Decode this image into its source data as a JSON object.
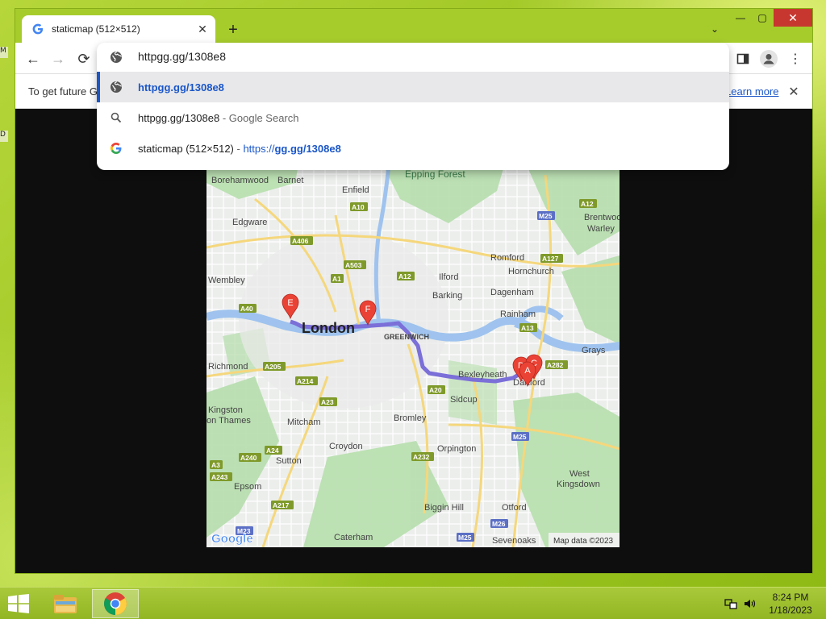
{
  "desktop": {
    "left_edge_items": [
      "M",
      "D"
    ]
  },
  "browser": {
    "tab_title": "staticmap (512×512)",
    "tab_close": "✕",
    "new_tab": "+",
    "tab_search": "⌄",
    "window_controls": {
      "minimize": "—",
      "maximize": "▢",
      "close": "✕"
    },
    "nav": {
      "back": "←",
      "forward": "→",
      "reload": "⟳"
    },
    "menu": "⋮",
    "infobar": {
      "text": "To get future G",
      "link": "Learn more",
      "close": "✕"
    }
  },
  "omnibox": {
    "input_value": "httpgg.gg/1308e8",
    "suggestions": [
      {
        "icon": "globe-icon",
        "parts": [
          {
            "text": "httpgg.gg/1308e8",
            "style": "bold-blue"
          }
        ],
        "selected": true
      },
      {
        "icon": "search-icon",
        "parts": [
          {
            "text": "httpgg.gg/1308e8",
            "style": ""
          },
          {
            "text": " - Google Search",
            "style": "muted"
          }
        ],
        "selected": false
      },
      {
        "icon": "google-icon",
        "parts": [
          {
            "text": "staticmap (512×512)",
            "style": ""
          },
          {
            "text": " - ",
            "style": "muted"
          },
          {
            "text": "https://",
            "style": "link-blue"
          },
          {
            "text": "gg.gg/1308e8",
            "style": "bold-blue"
          }
        ],
        "selected": false
      }
    ]
  },
  "map": {
    "city_label": "London",
    "attribution": "Map data ©2023",
    "logo": "Google",
    "places": [
      {
        "name": "Epping Forest"
      },
      {
        "name": "Borehamwood"
      },
      {
        "name": "Barnet"
      },
      {
        "name": "Enfield"
      },
      {
        "name": "Edgware"
      },
      {
        "name": "Brentwood"
      },
      {
        "name": "Warley"
      },
      {
        "name": "Romford"
      },
      {
        "name": "Hornchurch"
      },
      {
        "name": "Wembley"
      },
      {
        "name": "Ilford"
      },
      {
        "name": "Dagenham"
      },
      {
        "name": "Barking"
      },
      {
        "name": "Rainham"
      },
      {
        "name": "GREENWICH"
      },
      {
        "name": "Grays"
      },
      {
        "name": "Richmond"
      },
      {
        "name": "Bexleyheath"
      },
      {
        "name": "Dartford"
      },
      {
        "name": "Sidcup"
      },
      {
        "name": "Kingston"
      },
      {
        "name": "on Thames"
      },
      {
        "name": "Mitcham"
      },
      {
        "name": "Bromley"
      },
      {
        "name": "Croydon"
      },
      {
        "name": "Orpington"
      },
      {
        "name": "Sutton"
      },
      {
        "name": "West"
      },
      {
        "name": "Kingsdown"
      },
      {
        "name": "Epsom"
      },
      {
        "name": "Biggin Hill"
      },
      {
        "name": "Otford"
      },
      {
        "name": "Caterham"
      },
      {
        "name": "Sevenoaks"
      }
    ],
    "roads": [
      {
        "label": "A10"
      },
      {
        "label": "A12"
      },
      {
        "label": "M25"
      },
      {
        "label": "A406"
      },
      {
        "label": "A503"
      },
      {
        "label": "A1"
      },
      {
        "label": "A12"
      },
      {
        "label": "A127"
      },
      {
        "label": "A40"
      },
      {
        "label": "A13"
      },
      {
        "label": "A205"
      },
      {
        "label": "A214"
      },
      {
        "label": "A282"
      },
      {
        "label": "A20"
      },
      {
        "label": "A23"
      },
      {
        "label": "M25"
      },
      {
        "label": "A24"
      },
      {
        "label": "A240"
      },
      {
        "label": "A232"
      },
      {
        "label": "A3"
      },
      {
        "label": "A243"
      },
      {
        "label": "A217"
      },
      {
        "label": "M23"
      },
      {
        "label": "M26"
      },
      {
        "label": "M25"
      }
    ],
    "markers": [
      {
        "label": "E"
      },
      {
        "label": "F"
      },
      {
        "label": "D"
      },
      {
        "label": "C"
      },
      {
        "label": "A"
      }
    ]
  },
  "taskbar": {
    "clock_time": "8:24 PM",
    "clock_date": "1/18/2023"
  }
}
